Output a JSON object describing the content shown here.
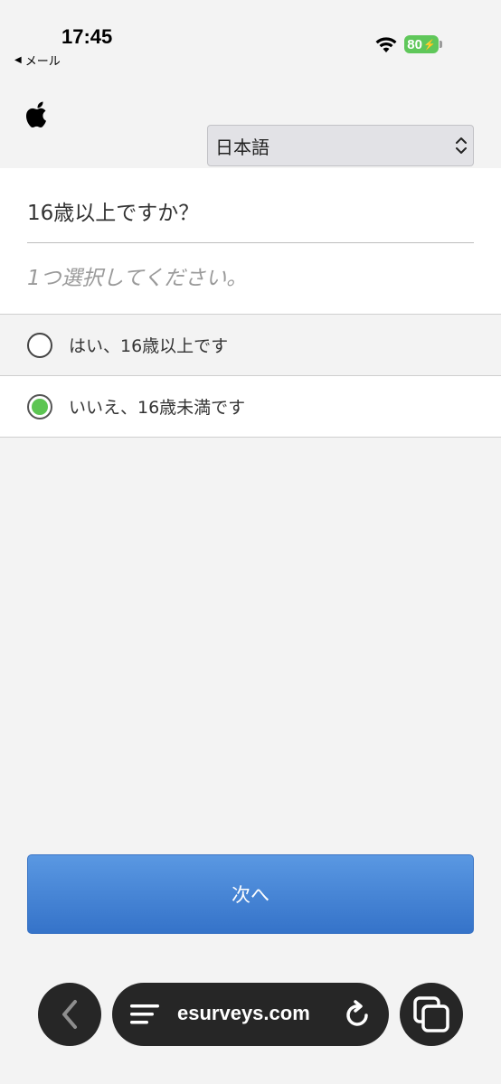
{
  "status_bar": {
    "time": "17:45",
    "back_app": "メール",
    "battery": "80"
  },
  "language_select": {
    "value": "日本語"
  },
  "question": {
    "title": "16歳以上ですか？",
    "instruction": "1つ選択してください。"
  },
  "options": [
    {
      "label": "はい、16歳以上です",
      "selected": false
    },
    {
      "label": "いいえ、16歳未満です",
      "selected": true
    }
  ],
  "next_button": {
    "label": "次へ"
  },
  "browser": {
    "url": "esurveys.com"
  },
  "colors": {
    "accent": "#3f7fd6",
    "radio_selected": "#5cc552",
    "battery": "#5fc75a"
  }
}
